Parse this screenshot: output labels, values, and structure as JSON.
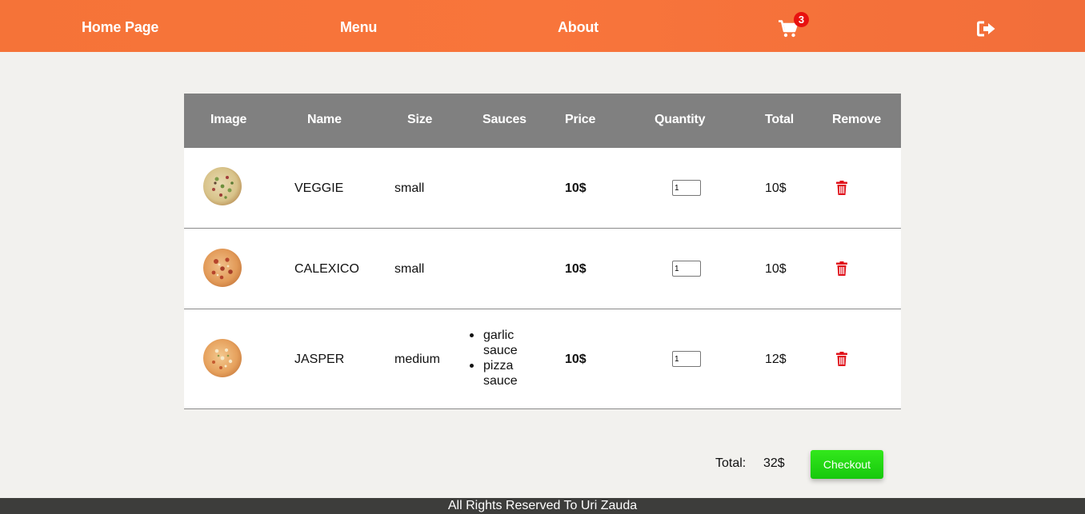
{
  "nav": {
    "home": "Home Page",
    "menu": "Menu",
    "about": "About",
    "cart_icon": "shopping-cart-icon",
    "cart_count": "3",
    "logout_icon": "sign-out-icon"
  },
  "table": {
    "headers": {
      "image": "Image",
      "name": "Name",
      "size": "Size",
      "sauces": "Sauces",
      "price": "Price",
      "quantity": "Quantity",
      "total": "Total",
      "remove": "Remove"
    },
    "rows": [
      {
        "name": "VEGGIE",
        "size": "small",
        "sauces": [],
        "price": "10$",
        "quantity": "1",
        "total": "10$"
      },
      {
        "name": "CALEXICO",
        "size": "small",
        "sauces": [],
        "price": "10$",
        "quantity": "1",
        "total": "10$"
      },
      {
        "name": "JASPER",
        "size": "medium",
        "sauces": [
          "garlic sauce",
          "pizza sauce"
        ],
        "price": "10$",
        "quantity": "1",
        "total": "12$"
      }
    ]
  },
  "summary": {
    "total_label": "Total:",
    "total_value": "32$",
    "checkout_label": "Checkout"
  },
  "footer": {
    "text": "All Rights Reserved To Uri Zauda"
  },
  "colors": {
    "nav_bg": "#f7723a",
    "header_bg": "#808080",
    "trash": "#e0101a",
    "checkout": "#22d614",
    "footer_bg": "#3d3d3b"
  }
}
